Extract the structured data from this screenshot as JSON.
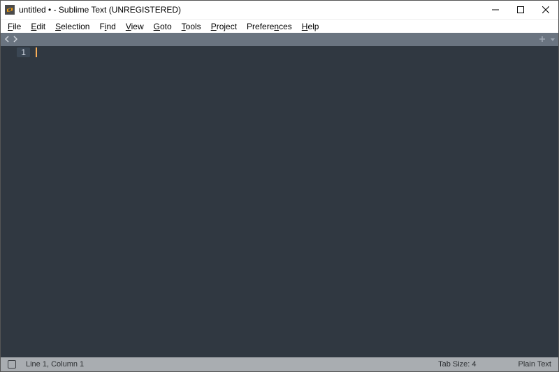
{
  "titlebar": {
    "title": "untitled • - Sublime Text (UNREGISTERED)"
  },
  "menubar": {
    "items": [
      {
        "ul": "F",
        "rest": "ile"
      },
      {
        "ul": "E",
        "rest": "dit"
      },
      {
        "ul": "S",
        "rest": "election"
      },
      {
        "ul": "",
        "rest": "F",
        "ul2": "i",
        "rest2": "nd"
      },
      {
        "ul": "V",
        "rest": "iew"
      },
      {
        "ul": "G",
        "rest": "oto"
      },
      {
        "ul": "T",
        "rest": "ools"
      },
      {
        "ul": "P",
        "rest": "roject"
      },
      {
        "ul": "",
        "rest": "Prefere",
        "ul2": "n",
        "rest2": "ces"
      },
      {
        "ul": "H",
        "rest": "elp"
      }
    ]
  },
  "editor": {
    "line_number": "1"
  },
  "statusbar": {
    "position": "Line 1, Column 1",
    "tab_size": "Tab Size: 4",
    "syntax": "Plain Text"
  }
}
